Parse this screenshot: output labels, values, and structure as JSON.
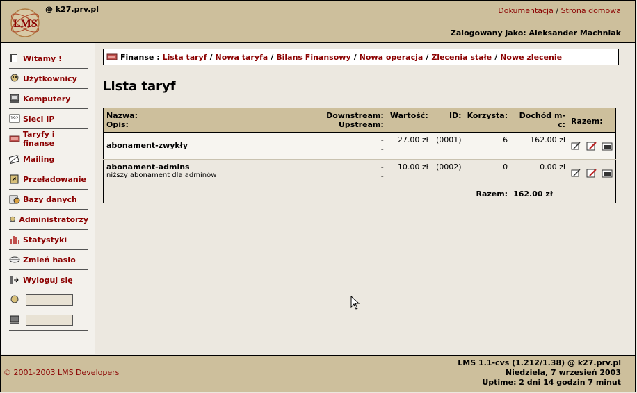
{
  "header": {
    "host": "@ k27.prv.pl",
    "link_docs": "Dokumentacja",
    "link_sep": "/",
    "link_home": "Strona domowa",
    "logged_in": "Zalogowany jako: Aleksander Machniak"
  },
  "sidebar": {
    "items": [
      {
        "label": "Witamy !",
        "icon": "book-icon"
      },
      {
        "label": "Użytkownicy",
        "icon": "users-icon"
      },
      {
        "label": "Komputery",
        "icon": "computer-icon"
      },
      {
        "label": "Sieci IP",
        "icon": "network-icon"
      },
      {
        "label": "Taryfy i finanse",
        "icon": "finance-icon"
      },
      {
        "label": "Mailing",
        "icon": "mail-icon"
      },
      {
        "label": "Przeładowanie",
        "icon": "reload-icon"
      },
      {
        "label": "Bazy danych",
        "icon": "database-icon"
      },
      {
        "label": "Administratorzy",
        "icon": "admin-icon"
      },
      {
        "label": "Statystyki",
        "icon": "stats-icon"
      },
      {
        "label": "Zmień hasło",
        "icon": "key-icon"
      },
      {
        "label": "Wyloguj się",
        "icon": "logout-icon"
      }
    ],
    "user_search_icon": "user-search-icon",
    "computer_search_icon": "computer-search-icon"
  },
  "breadcrumb": {
    "prefix": "Finanse :",
    "links": [
      "Lista taryf",
      "Nowa taryfa",
      "Bilans Finansowy",
      "Nowa operacja",
      "Zlecenia stałe",
      "Nowe zlecenie"
    ]
  },
  "page": {
    "title": "Lista taryf"
  },
  "table": {
    "headers": {
      "name": "Nazwa:",
      "desc": "Opis:",
      "downstream": "Downstream:",
      "upstream": "Upstream:",
      "value": "Wartość:",
      "id": "ID:",
      "users": "Korzysta:",
      "income": "Dochód m-c:",
      "total": "Razem:"
    },
    "rows": [
      {
        "name": "abonament-zwykły",
        "desc": "",
        "downstream": "-",
        "upstream": "-",
        "value": "27.00 zł",
        "id": "(0001)",
        "users": "6",
        "income": "162.00 zł"
      },
      {
        "name": "abonament-admins",
        "desc": "niższy abonament dla adminów",
        "downstream": "-",
        "upstream": "-",
        "value": "10.00 zł",
        "id": "(0002)",
        "users": "0",
        "income": "0.00 zł"
      }
    ],
    "footer_label": "Razem:",
    "footer_value": "162.00 zł"
  },
  "footer": {
    "copyright": "© 2001-2003 LMS Developers",
    "version": "LMS 1.1-cvs (1.212/1.38) @ k27.prv.pl",
    "date": "Niedziela, 7 wrzesień 2003",
    "uptime": "Uptime: 2 dni 14 godzin 7 minut"
  },
  "colors": {
    "accent": "#8b0000",
    "bar": "#cdbf9c",
    "background": "#ece8e0"
  }
}
